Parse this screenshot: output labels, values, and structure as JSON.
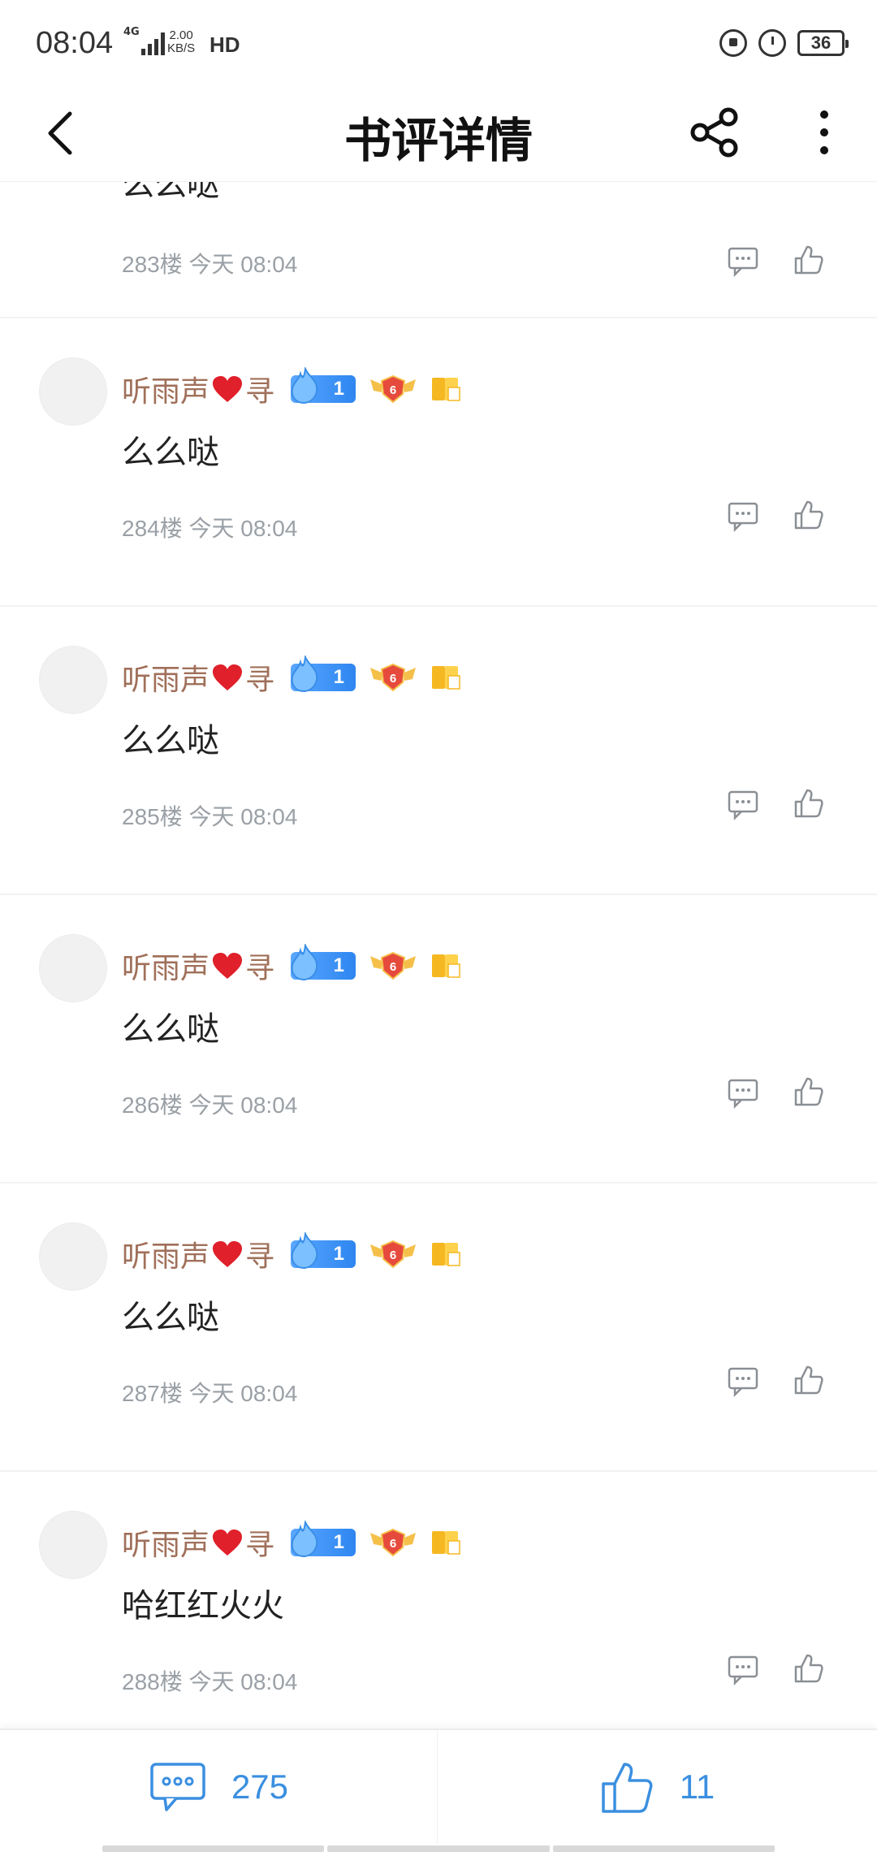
{
  "status_bar": {
    "time": "08:04",
    "network": "4G",
    "speed_value": "2.00",
    "speed_unit": "KB/S",
    "hd": "HD",
    "battery": "36"
  },
  "header": {
    "title": "书评详情",
    "back_icon": "chevron-left-icon",
    "share_icon": "share-icon",
    "more_icon": "more-vertical-icon"
  },
  "partial_comment": {
    "content": "么么哒",
    "floor": "283楼",
    "time": "今天 08:04"
  },
  "comments": [
    {
      "username_a": "听雨声",
      "username_b": "寻",
      "fan_level": "1",
      "user_level": "6",
      "content": "么么哒",
      "floor": "284楼",
      "time": "今天 08:04"
    },
    {
      "username_a": "听雨声",
      "username_b": "寻",
      "fan_level": "1",
      "user_level": "6",
      "content": "么么哒",
      "floor": "285楼",
      "time": "今天 08:04"
    },
    {
      "username_a": "听雨声",
      "username_b": "寻",
      "fan_level": "1",
      "user_level": "6",
      "content": "么么哒",
      "floor": "286楼",
      "time": "今天 08:04"
    },
    {
      "username_a": "听雨声",
      "username_b": "寻",
      "fan_level": "1",
      "user_level": "6",
      "content": "么么哒",
      "floor": "287楼",
      "time": "今天 08:04"
    },
    {
      "username_a": "听雨声",
      "username_b": "寻",
      "fan_level": "1",
      "user_level": "6",
      "content": "哈红红火火",
      "floor": "288楼",
      "time": "今天 08:04"
    }
  ],
  "bottom_bar": {
    "comment_count": "275",
    "like_count": "11"
  },
  "colors": {
    "username": "#a0705a",
    "accent_blue": "#3b8fe0",
    "meta_gray": "#9aa0a6",
    "heart_red": "#e0202a"
  }
}
